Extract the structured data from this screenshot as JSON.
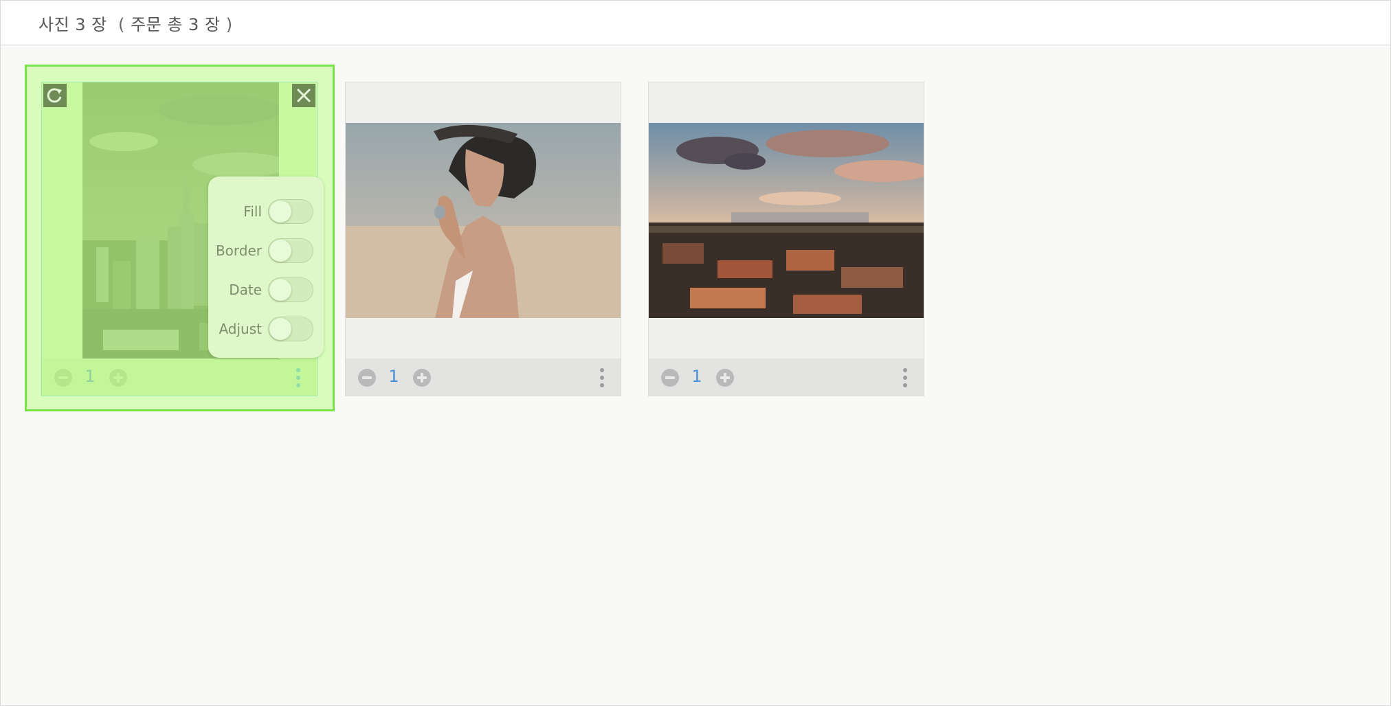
{
  "header": {
    "count_label": "사진 3 장",
    "order_open": "(",
    "order_label": "주문 총 3 장",
    "order_close": ")"
  },
  "photos": [
    {
      "subject": "city skyline",
      "quantity": "1",
      "selected": true,
      "actions": {
        "rotate_icon": "rotate-icon",
        "close_icon": "close-icon"
      },
      "options": [
        {
          "label": "Fill",
          "on": false
        },
        {
          "label": "Border",
          "on": false
        },
        {
          "label": "Date",
          "on": false
        },
        {
          "label": "Adjust",
          "on": false
        }
      ]
    },
    {
      "subject": "woman with hat",
      "quantity": "1",
      "selected": false
    },
    {
      "subject": "city at sunset",
      "quantity": "1",
      "selected": false
    }
  ],
  "colors": {
    "selection_border": "#7be34a",
    "selection_fill": "#beff8c",
    "quantity_text": "#4a90d9"
  },
  "icons": {
    "minus": "minus-circle-icon",
    "plus": "plus-circle-icon",
    "more": "more-vertical-icon"
  }
}
